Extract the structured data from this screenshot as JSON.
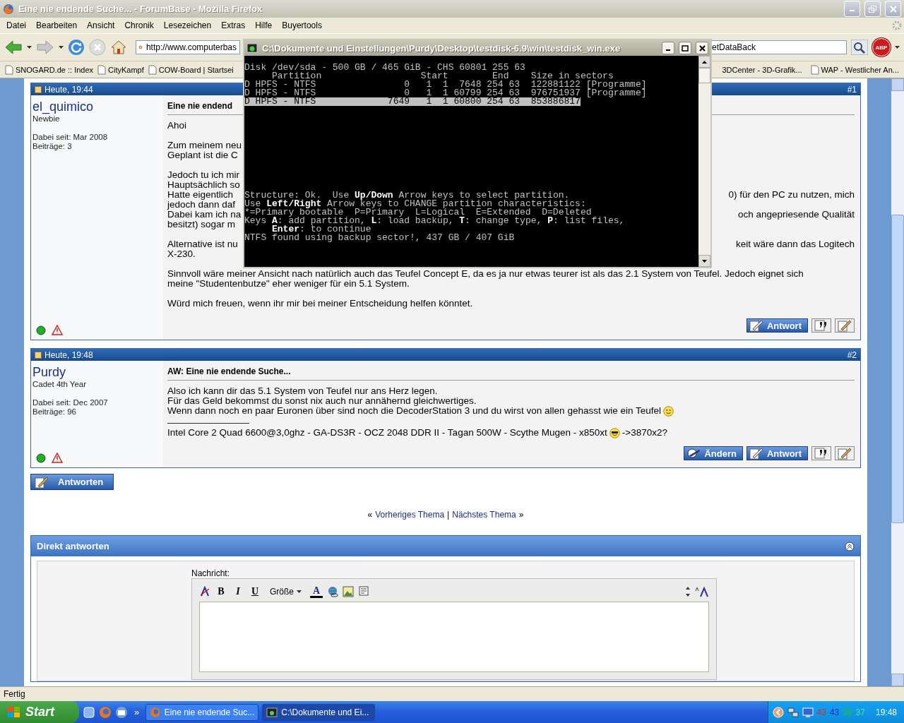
{
  "window": {
    "title": "Eine nie endende Suche... - ForumBase - Mozilla Firefox"
  },
  "menu": [
    "Datei",
    "Bearbeiten",
    "Ansicht",
    "Chronik",
    "Lesezeichen",
    "Extras",
    "Hilfe",
    "Buyertools"
  ],
  "address": {
    "value": "http://www.computerbas"
  },
  "search": {
    "value": "etDataBack"
  },
  "adblock": "ABP",
  "bookmarks_left": [
    "SNOGARD.de :: Index",
    "CityKampf",
    "COW-Board | Startsei"
  ],
  "bookmarks_right": [
    "3DCenter - 3D-Grafik...",
    "WAP - Westlicher An..."
  ],
  "posts": [
    {
      "time": "Heute, 19:44",
      "number": "#1",
      "author": "el_quimico",
      "rank": "Newbie",
      "joined": "Dabei seit: Mar 2008",
      "count": "Beiträge: 3",
      "online": true,
      "title": "Eine nie endend",
      "paragraphs": [
        [
          {
            "text": "Ahoi"
          }
        ],
        [
          {
            "start": "Zum meinem neu"
          },
          {
            "start": "Geplant ist die C"
          }
        ],
        [
          {
            "start": "Jedoch tu ich mir"
          },
          {
            "start": "Hauptsächlich so"
          },
          {
            "start": "Hatte eigentlich",
            "end": "0) für den PC zu nutzen, mich"
          },
          {
            "start": "jedoch dann daf"
          },
          {
            "start": "Dabei kam ich na",
            "end": "och angepriesende Qualität"
          },
          {
            "start": "besitzt) sogar m"
          }
        ],
        [
          {
            "start": "Alternative ist nu",
            "end": "keit wäre dann das Logitech"
          },
          {
            "start": "X-230."
          }
        ],
        [
          {
            "text": "Sinnvoll wäre meiner Ansicht nach natürlich auch das Teufel Concept E, da es ja nur etwas teurer ist als das 2.1 System von Teufel. Jedoch eignet sich"
          },
          {
            "text": "meine \"Studentenbutze\" eher weniger für ein 5.1 System."
          }
        ],
        [
          {
            "text": "Würd mich freuen, wenn ihr mir bei meiner Entscheidung helfen könntet."
          }
        ]
      ],
      "buttons": [
        {
          "kind": "reply",
          "label": "Antwort"
        },
        {
          "kind": "quote"
        },
        {
          "kind": "edit"
        }
      ]
    },
    {
      "time": "Heute, 19:48",
      "number": "#2",
      "author": "Purdy",
      "rank": "Cadet 4th Year",
      "joined": "Dabei seit: Dec 2007",
      "count": "Beiträge: 96",
      "online": true,
      "title": "AW: Eine nie endende Suche...",
      "paragraphs": [
        [
          {
            "text": "Also ich kann dir das 5.1 System von Teufel nur ans Herz legen.",
            "smiley": false
          },
          {
            "text": "Für das Geld bekommst du sonst nix auch nur annähernd gleichwertiges.",
            "smiley": false
          },
          {
            "text": "Wenn dann noch en paar Euronen über sind noch die DecoderStation 3 und du wirst von allen gehasst wie ein Teufel",
            "smiley": true
          }
        ]
      ],
      "signature": {
        "before": "Intel Core 2 Quad 6600@3,0ghz - GA-DS3R - OCZ 2048 DDR II - Tagan 500W - Scythe Mugen - x850xt",
        "after": "->3870x2?"
      },
      "buttons": [
        {
          "kind": "change",
          "label": "Ändern"
        },
        {
          "kind": "reply",
          "label": "Antwort"
        },
        {
          "kind": "quote"
        },
        {
          "kind": "edit"
        }
      ]
    }
  ],
  "reply_button": "Antworten",
  "thread_nav": {
    "open": "«",
    "prev": "Vorheriges Thema",
    "separator": "|",
    "next": "Nächstes Thema",
    "close": "»"
  },
  "quick_reply": {
    "title": "Direkt antworten",
    "label": "Nachricht:",
    "bold": "B",
    "italic": "I",
    "underline": "U",
    "size": "Größe",
    "font_color_button": "A"
  },
  "status_bar": "Fertig",
  "console": {
    "title": "C:\\Dokumente und Einstellungen\\Purdy\\Desktop\\testdisk-6.9\\win\\testdisk_win.exe",
    "header": [
      "Disk /dev/sda - 500 GB / 465 GiB - CHS 60801 255 63",
      "     Partition                  Start        End    Size in sectors"
    ],
    "partitions": [
      {
        "text": "D HPFS - NTFS                0   1  1  7648 254 63  122881122 [Programme]",
        "selected": false
      },
      {
        "text": "D HPFS - NTFS                0   1  1 60799 254 63  976751937 [Programme]",
        "selected": false
      },
      {
        "text": "D HPFS - NTFS             7649   1  1 60800 254 63  853886817",
        "selected": true
      }
    ],
    "footer": [
      {
        "kind": "marked",
        "text": "Structure: Ok.  Use **Up/Down** Arrow keys to select partition."
      },
      {
        "kind": "marked",
        "text": "Use **Left/Right** Arrow keys to CHANGE partition characteristics:"
      },
      {
        "kind": "plain",
        "text": "*=Primary bootable  P=Primary  L=Logical  E=Extended  D=Deleted"
      },
      {
        "kind": "marked",
        "text": "Keys **A**: add partition, **L**: load backup, **T**: change type, **P**: list files,"
      },
      {
        "kind": "marked",
        "text": "     **Enter**: to continue"
      },
      {
        "kind": "plain",
        "text": "NTFS found using backup sector!, 437 GB / 407 GiB"
      }
    ]
  },
  "taskbar": {
    "start": "Start",
    "more": "»",
    "tasks": [
      {
        "label": "Eine nie endende Suc...",
        "selected": false
      },
      {
        "label": "C:\\Dokumente und Ei...",
        "selected": true
      }
    ],
    "temps": [
      {
        "value": "43",
        "color": "#e02828"
      },
      {
        "value": "43",
        "color": "#2828c8"
      },
      {
        "value": "38",
        "color": "#28c028"
      },
      {
        "value": "37",
        "color": "#50e0a0"
      }
    ],
    "clock": "19:48"
  }
}
